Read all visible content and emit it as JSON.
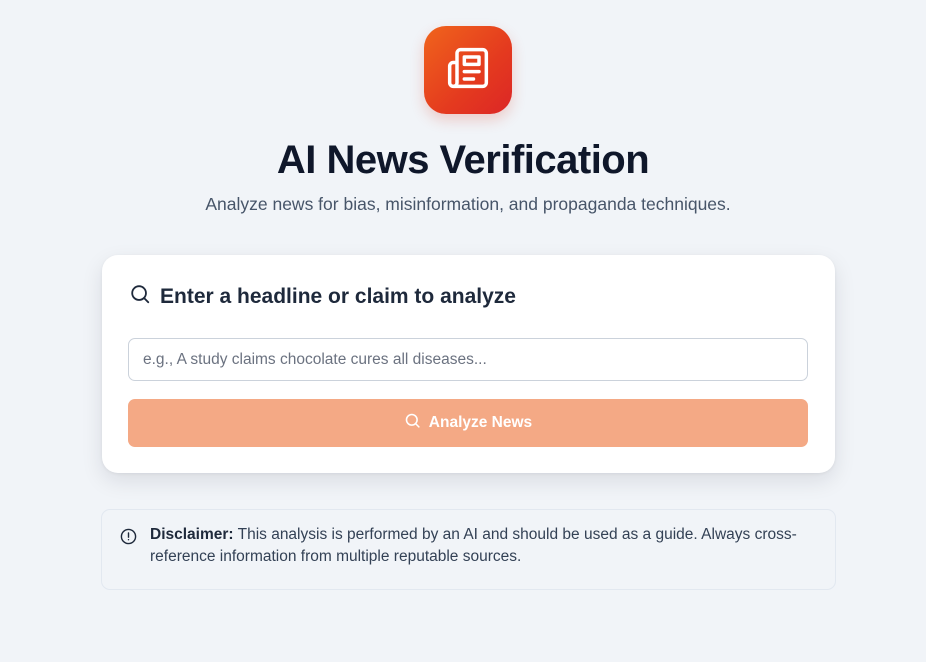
{
  "header": {
    "logo_icon": "newspaper-icon",
    "title": "AI News Verification",
    "subtitle": "Analyze news for bias, misinformation, and propaganda techniques."
  },
  "card": {
    "heading_icon": "search-icon",
    "heading": "Enter a headline or claim to analyze",
    "input": {
      "value": "",
      "placeholder": "e.g., A study claims chocolate cures all diseases..."
    },
    "analyze_button": {
      "icon": "search-icon",
      "label": "Analyze News",
      "state": "disabled"
    }
  },
  "disclaimer": {
    "icon": "info-circle-icon",
    "label": "Disclaimer:",
    "text": " This analysis is performed by an AI and should be used as a guide. Always cross-reference information from multiple reputable sources."
  },
  "colors": {
    "background": "#f1f4f8",
    "accent_start": "#f0641c",
    "accent_end": "#dc2626",
    "button_disabled": "#f4a985"
  }
}
